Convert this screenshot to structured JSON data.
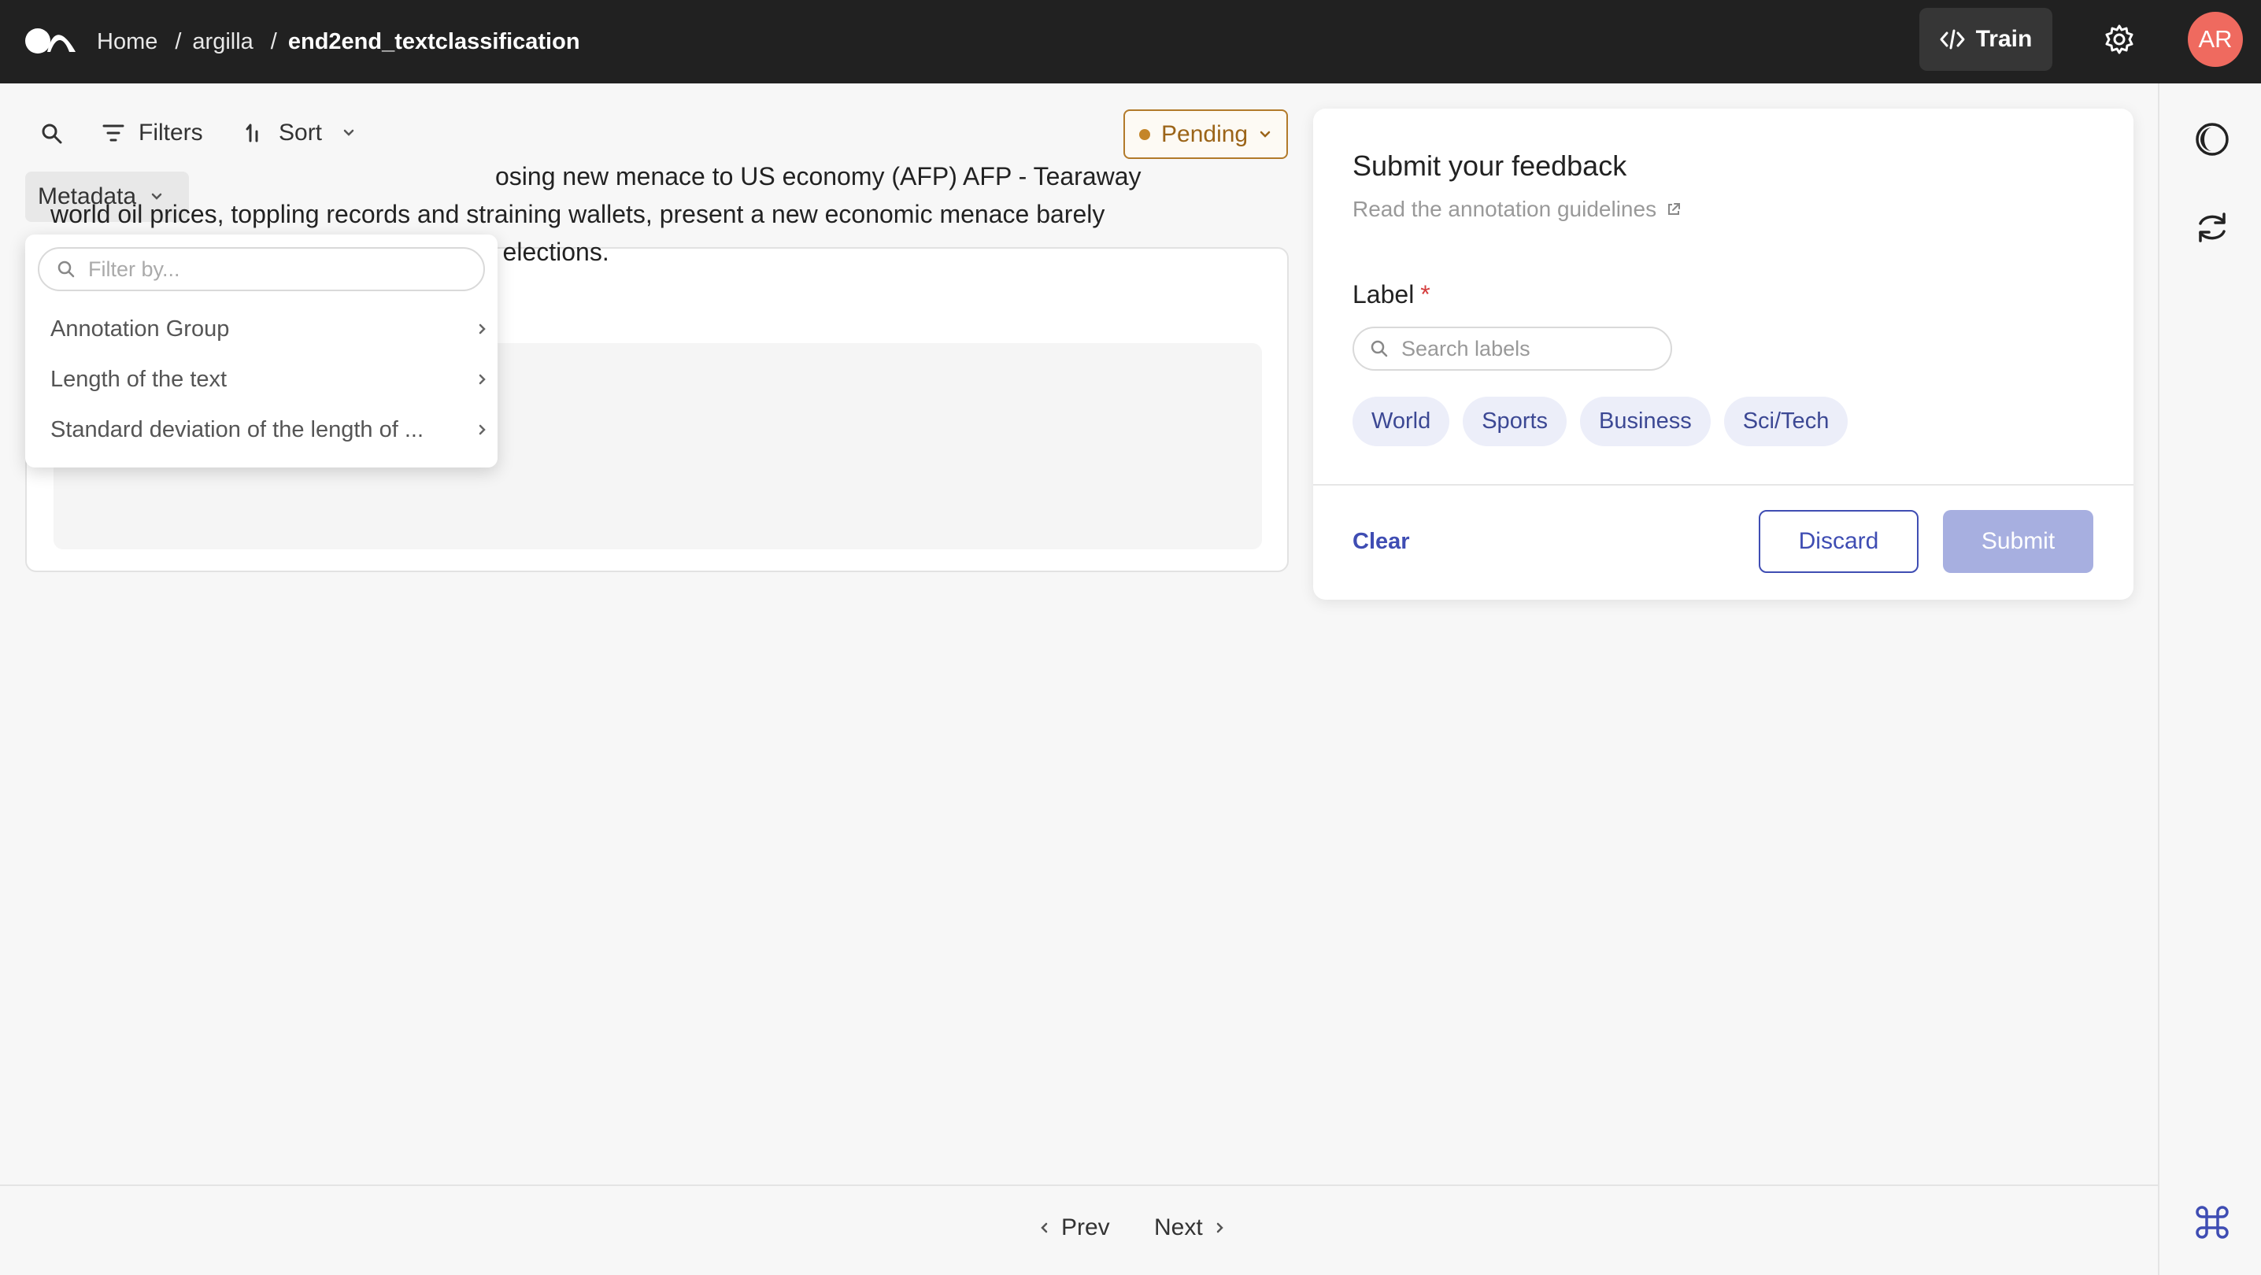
{
  "header": {
    "breadcrumbs": [
      "Home",
      "argilla",
      "end2end_textclassification"
    ],
    "separator": "/",
    "train_label": "Train",
    "avatar_initials": "AR",
    "logo_icon": "argilla-logo-icon"
  },
  "toolbar": {
    "search_icon": "search-icon",
    "filters_label": "Filters",
    "sort_label": "Sort",
    "metadata_label": "Metadata",
    "status_value": "Pending"
  },
  "metadata_dropdown": {
    "search_placeholder": "Filter by...",
    "items": [
      {
        "label": "Annotation Group"
      },
      {
        "label": "Length of the text"
      },
      {
        "label": "Standard deviation of the length of ..."
      }
    ]
  },
  "record": {
    "visible_text_line1_tail": "osing new menace to US economy (AFP) AFP - Tearaway",
    "visible_text_line2": "world oil prices, toppling records and straining wallets, present a new economic menace barely",
    "visible_text_line3": "three months before the US presidential elections."
  },
  "feedback": {
    "title": "Submit your feedback",
    "guidelines_link": "Read the annotation guidelines",
    "question_label": "Label",
    "required_mark": "*",
    "search_placeholder": "Search labels",
    "labels": [
      "World",
      "Sports",
      "Business",
      "Sci/Tech"
    ],
    "clear_label": "Clear",
    "discard_label": "Discard",
    "submit_label": "Submit"
  },
  "pagination": {
    "prev_label": "Prev",
    "next_label": "Next"
  },
  "colors": {
    "topbar": "#212121",
    "accent": "#3f4db3",
    "pending": "#b27a2a",
    "avatar": "#ef6a5f",
    "submit_disabled": "#a7afe0"
  }
}
